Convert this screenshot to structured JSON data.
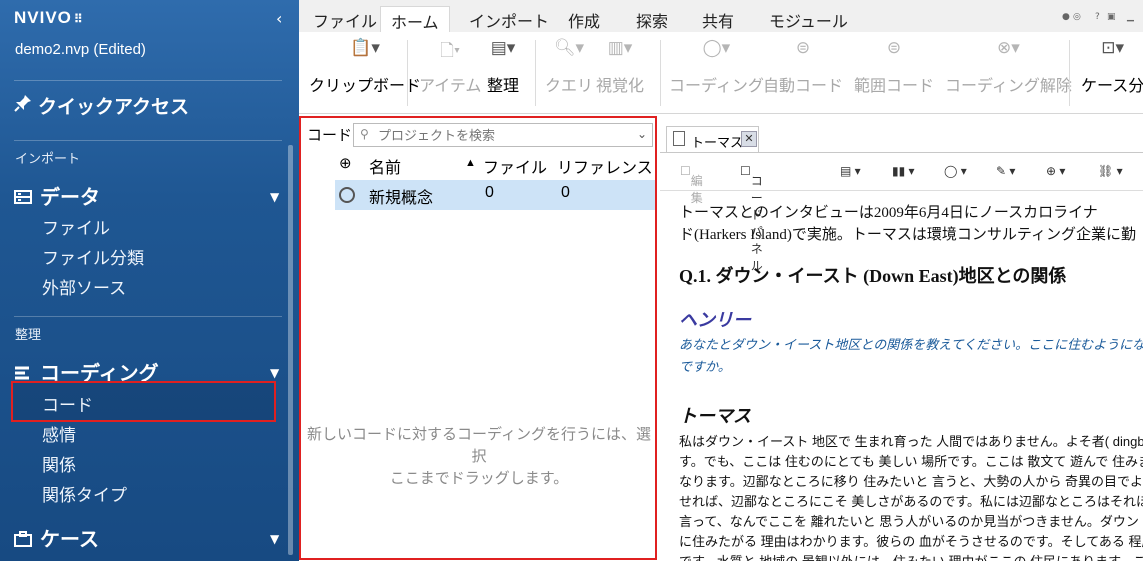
{
  "app": {
    "logo": "NVIVO",
    "logo_mark": "⠿",
    "project": "demo2.nvp (Edited)"
  },
  "sidebar": {
    "quick_access": "クイックアクセス",
    "sections": {
      "import": "インポート",
      "organize": "整理"
    },
    "data_group": {
      "label": "データ",
      "items": [
        "ファイル",
        "ファイル分類",
        "外部ソース"
      ]
    },
    "coding_group": {
      "label": "コーディング",
      "items": [
        "コード",
        "感情",
        "関係",
        "関係タイプ"
      ]
    },
    "case_group": {
      "label": "ケース"
    },
    "selected_item": "コード"
  },
  "ribbon": {
    "tabs": [
      "ファイル",
      "ホーム",
      "インポート",
      "作成",
      "探索",
      "共有",
      "モジュール"
    ],
    "active_tab": "ホーム",
    "buttons": [
      "クリップボード",
      "アイテム",
      "整理",
      "クエリ",
      "視覚化",
      "コーディング",
      "自動コード",
      "範囲コード",
      "コーディング解除",
      "ケース分"
    ]
  },
  "codes_panel": {
    "label": "コード",
    "search_placeholder": "プロジェクトを検索",
    "columns": {
      "name": "名前",
      "files": "ファイル",
      "references": "リファレンス"
    },
    "rows": [
      {
        "name": "新規概念",
        "files": "0",
        "references": "0"
      }
    ],
    "hint_line1": "新しいコードに対するコーディングを行うには、選択",
    "hint_line2": "ここまでドラッグします。"
  },
  "document": {
    "tab_title": "トーマス",
    "toolbar": {
      "edit": "編集",
      "code_panel": "コードパネル"
    },
    "intro_line1": "トーマスとのインタビューは2009年6月4日にノースカロライナ",
    "intro_line2": "ド(Harkers Island)で実施。トーマスは環境コンサルティング企業に勤",
    "heading": "Q.1. ダウン・イースト (Down East)地区との関係",
    "speaker1": "ヘンリー",
    "question_line1": "あなたとダウン・イースト地区との関係を教えてください。ここに住むようになら",
    "question_line2": "ですか。",
    "speaker2": "トーマス",
    "body_lines": [
      "私はダウン・イースト 地区で 生まれ育った 人間ではありません。よそ者( dingbatte",
      "す。でも、ここは 住むのにとても 美しい 場所です。ここは 散文て 遊んで 住みました。",
      "なります。辺鄙なところに移り 住みたいと 言うと、大勢の人から 奇異の目でよく 見ら",
      "せれば、辺鄙なところにこそ 美しさがあるのです。私には辺鄙なところはそれほど",
      "言って、なんでここを 離れたいと 思う人がいるのか見当がつきません。ダウン・イ",
      "に住みたがる 理由はわかります。彼らの 血がそうさせるのです。そしてある 程度そ",
      "です。水質と 地域の 景観以外には、住みたい 理由がここの 住民にあります。ここの住"
    ]
  }
}
